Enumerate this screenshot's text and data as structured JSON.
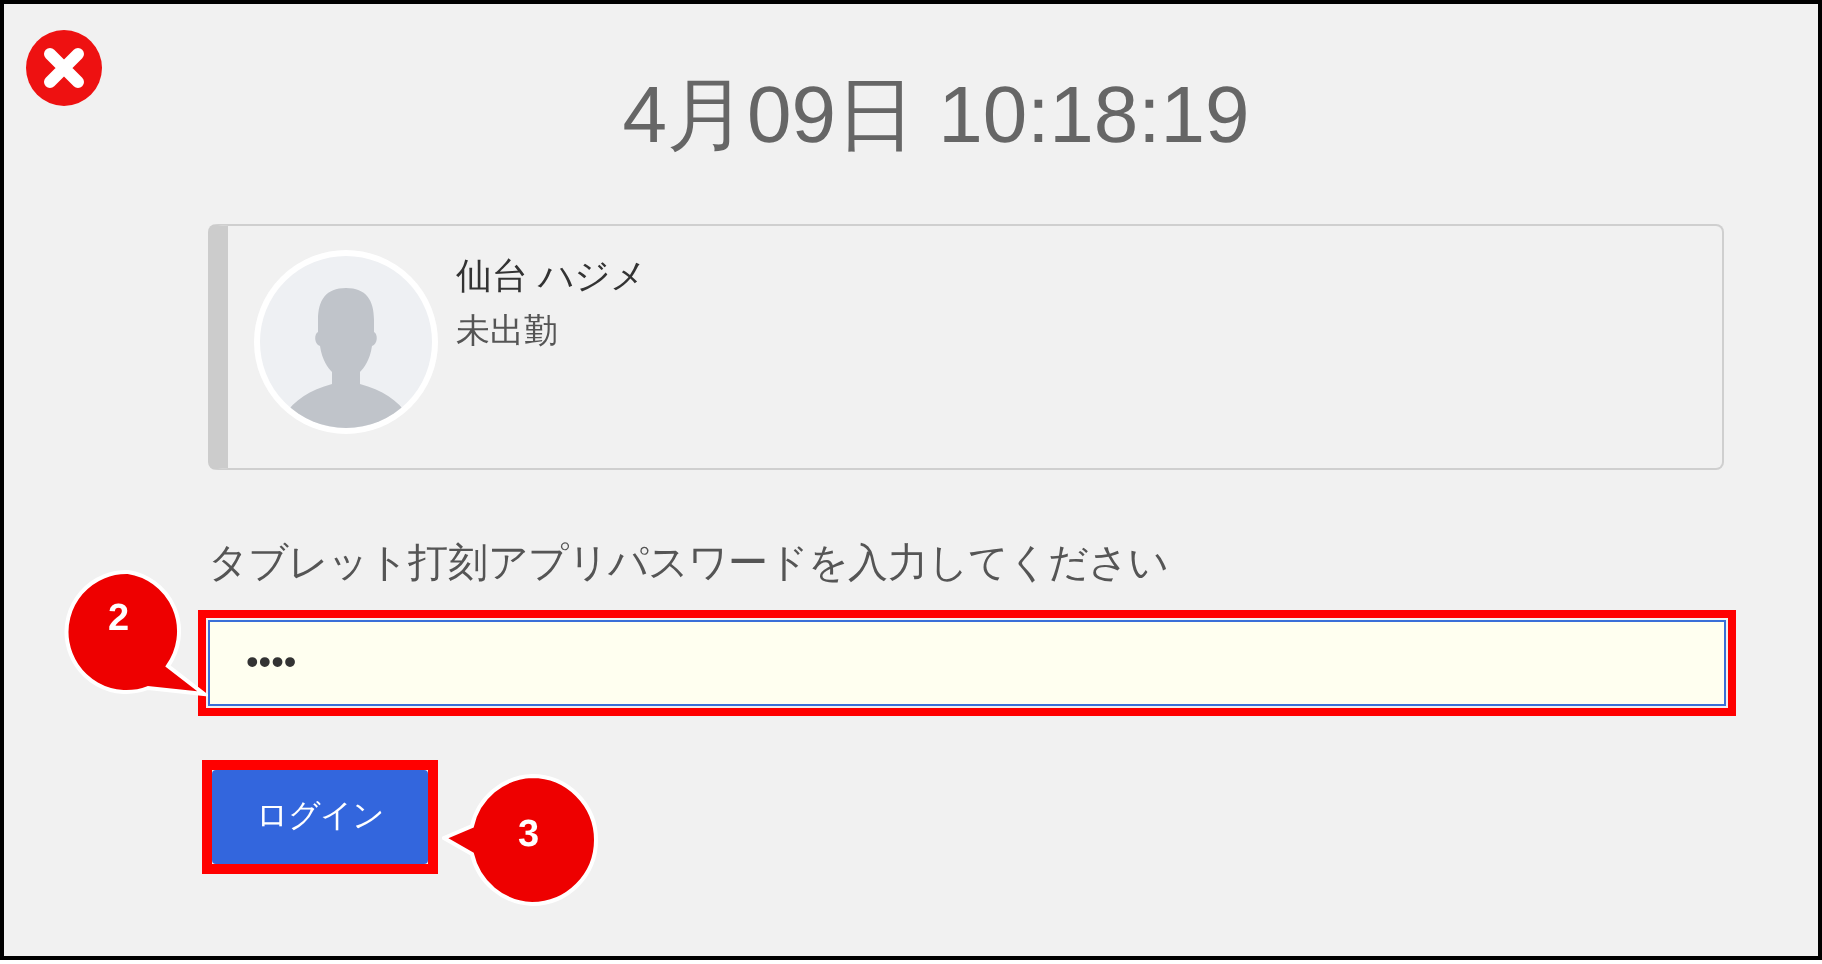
{
  "datetime": "4月09日 10:18:19",
  "user": {
    "name": "仙台 ハジメ",
    "status": "未出勤"
  },
  "prompt": "タブレット打刻アプリパスワードを入力してください",
  "password_field": {
    "value": "••••",
    "highlighted": true
  },
  "login_button": {
    "label": "ログイン",
    "highlighted": true
  },
  "callouts": [
    {
      "number": "2"
    },
    {
      "number": "3"
    }
  ]
}
